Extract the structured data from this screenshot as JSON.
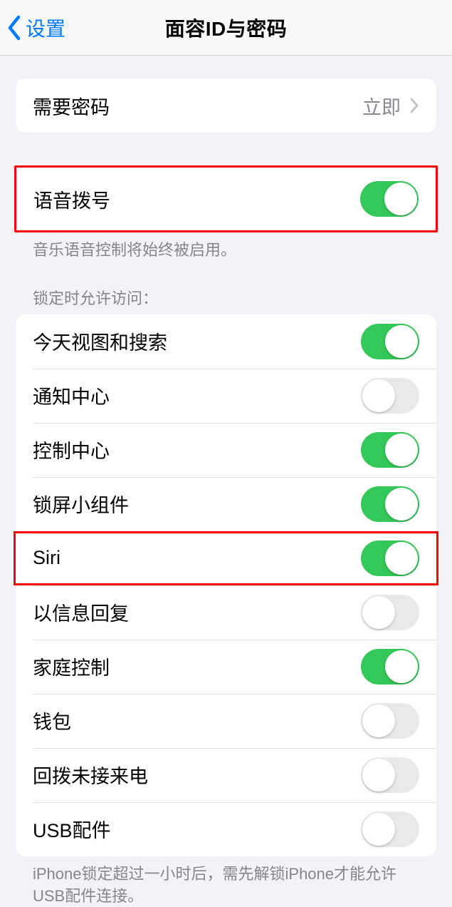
{
  "nav": {
    "back_label": "设置",
    "title": "面容ID与密码"
  },
  "require_passcode": {
    "label": "需要密码",
    "value": "立即"
  },
  "voice_dial": {
    "label": "语音拨号",
    "enabled": true,
    "footer": "音乐语音控制将始终被启用。"
  },
  "lock_access": {
    "header": "锁定时允许访问：",
    "items": [
      {
        "label": "今天视图和搜索",
        "enabled": true
      },
      {
        "label": "通知中心",
        "enabled": false
      },
      {
        "label": "控制中心",
        "enabled": true
      },
      {
        "label": "锁屏小组件",
        "enabled": true
      },
      {
        "label": "Siri",
        "enabled": true
      },
      {
        "label": "以信息回复",
        "enabled": false
      },
      {
        "label": "家庭控制",
        "enabled": true
      },
      {
        "label": "钱包",
        "enabled": false
      },
      {
        "label": "回拨未接来电",
        "enabled": false
      },
      {
        "label": "USB配件",
        "enabled": false
      }
    ],
    "footer": "iPhone锁定超过一小时后，需先解锁iPhone才能允许USB配件连接。"
  }
}
